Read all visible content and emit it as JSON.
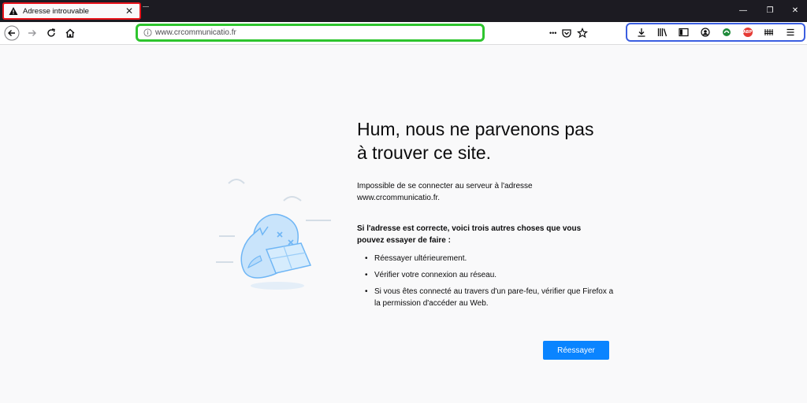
{
  "tab": {
    "title": "Adresse introuvable"
  },
  "window_controls": {
    "minimize": "—",
    "restore": "❐",
    "close": "✕"
  },
  "urlbar": {
    "url": "www.crcommunicatio.fr",
    "more": "•••"
  },
  "error": {
    "title_line1": "Hum, nous ne parvenons pas",
    "title_line2": "à trouver ce site.",
    "description": "Impossible de se connecter au serveur à l'adresse www.crcommunicatio.fr.",
    "suggestions_heading": "Si l'adresse est correcte, voici trois autres choses que vous pouvez essayer de faire :",
    "suggestions": [
      "Réessayer ultérieurement.",
      "Vérifier votre connexion au réseau.",
      "Si vous êtes connecté au travers d'un pare-feu, vérifier que Firefox a la permission d'accéder au Web."
    ],
    "retry_label": "Réessayer"
  },
  "toolbar": {
    "adblock_label": "ABP"
  },
  "colors": {
    "accent": "#0a84ff",
    "tab_highlight": "#e8141c",
    "url_highlight": "#2ec52e",
    "toolbar_highlight": "#3b5ee0"
  }
}
